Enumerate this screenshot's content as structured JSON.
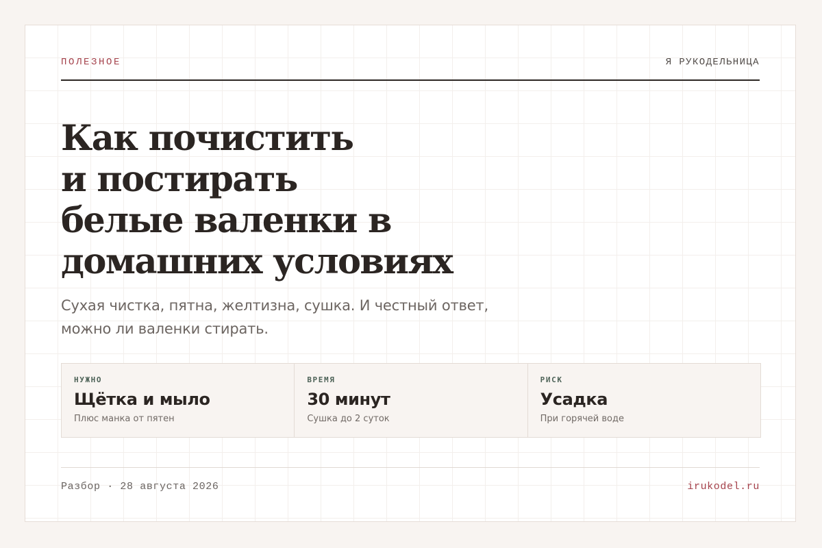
{
  "header": {
    "kicker": "ПОЛЕЗНОЕ",
    "brand": "Я РУКОДЕЛЬНИЦА"
  },
  "article": {
    "title_lines": [
      "Как почистить",
      "и постирать",
      "белые валенки в",
      "домашних условиях"
    ],
    "subtitle_lines": [
      "Сухая чистка, пятна, желтизна, сушка. И честный ответ,",
      "можно ли валенки стирать."
    ]
  },
  "facts": [
    {
      "label": "НУЖНО",
      "value": "Щётка и мыло",
      "note": "Плюс манка от пятен"
    },
    {
      "label": "ВРЕМЯ",
      "value": "30 минут",
      "note": "Сушка до 2 суток"
    },
    {
      "label": "РИСК",
      "value": "Усадка",
      "note": "При горячей воде"
    }
  ],
  "footer": {
    "byline": "Разбор · 28 августа 2026",
    "site": "irukodel.ru"
  },
  "colors": {
    "accent": "#a5424c",
    "ink": "#2b2522",
    "label_green": "#4e6358",
    "background": "#f8f4f1"
  }
}
